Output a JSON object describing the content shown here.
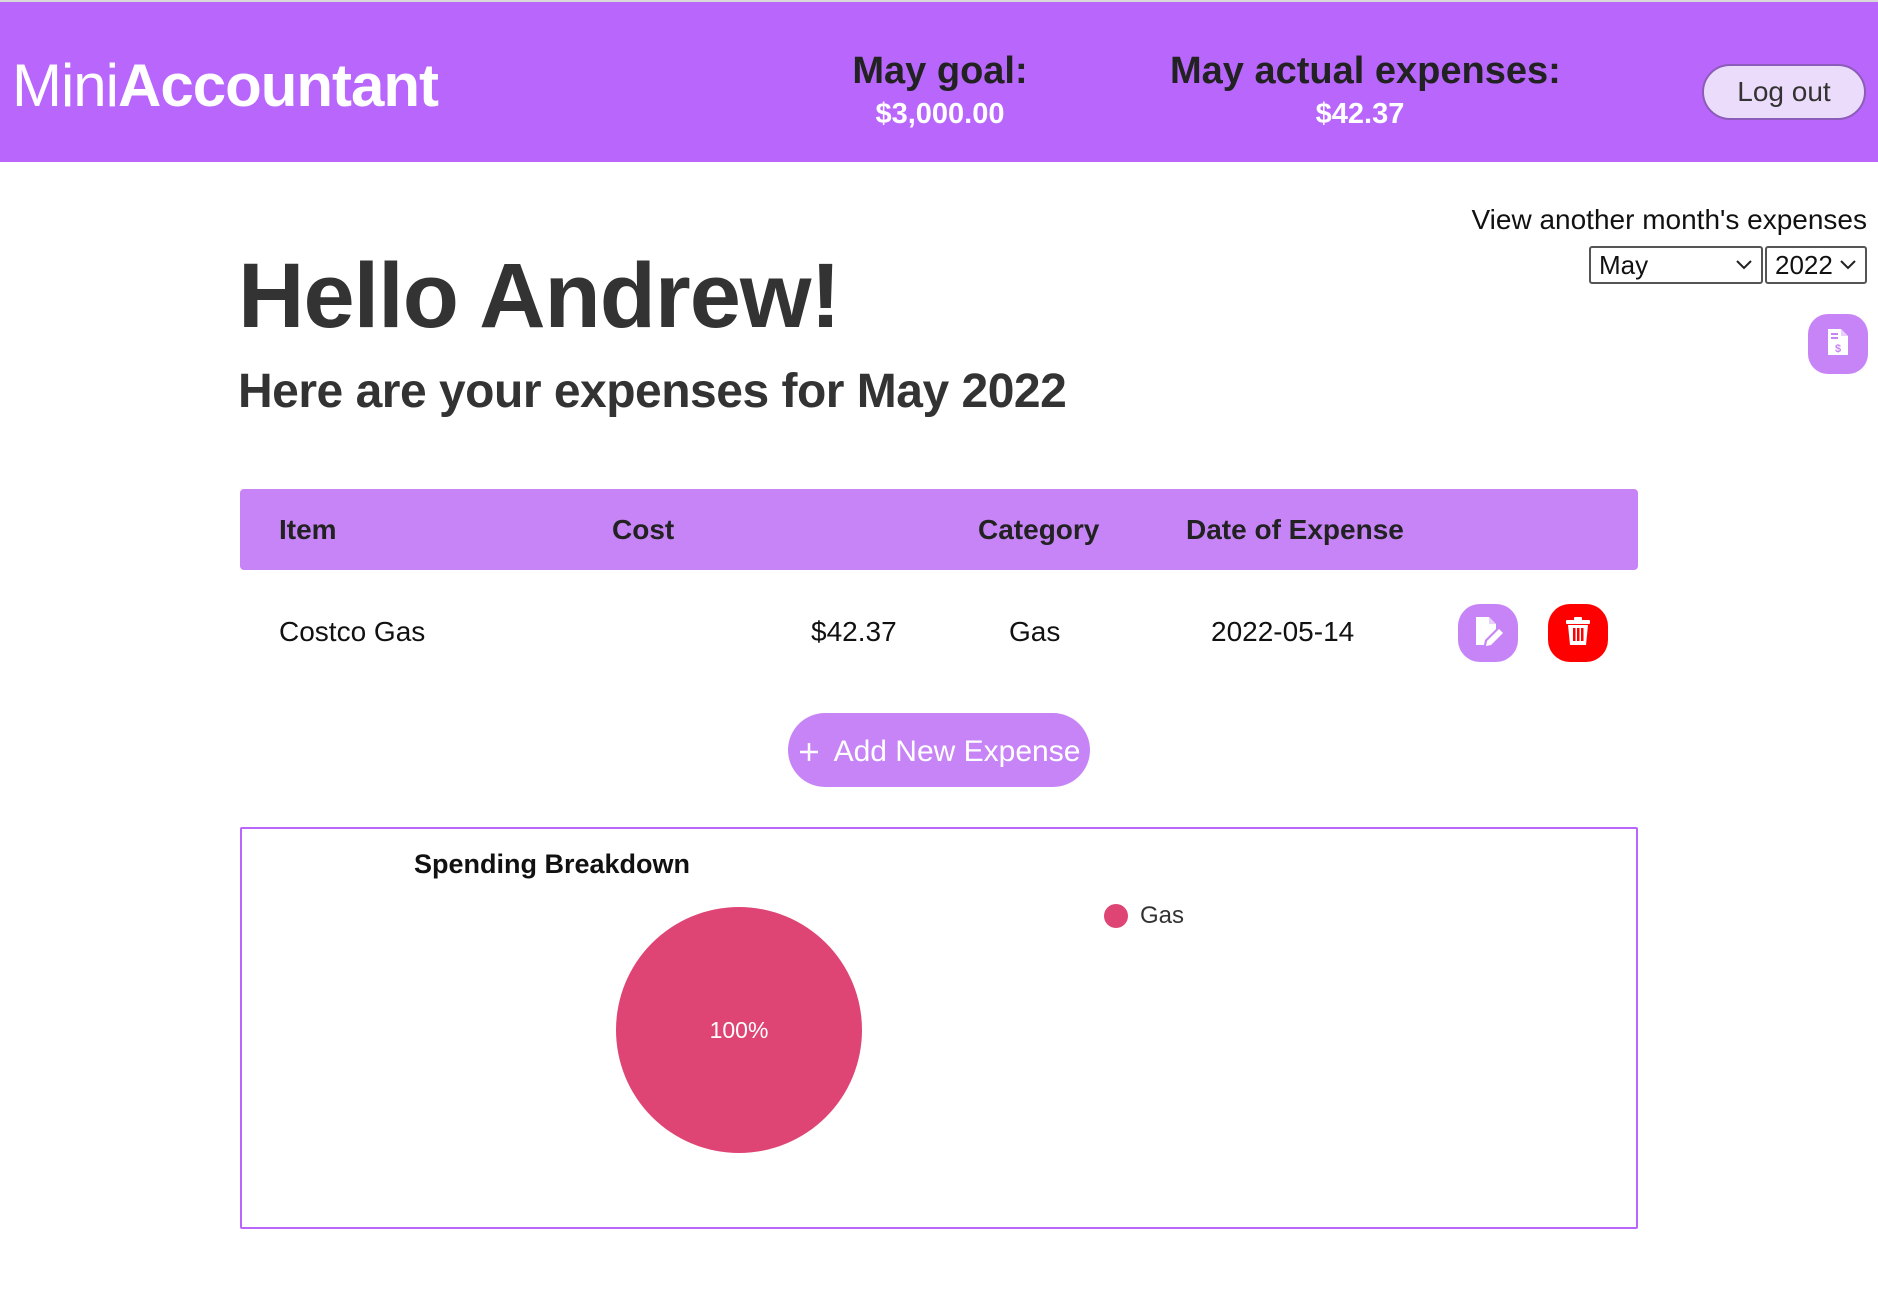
{
  "app": {
    "brand_light": "Mini",
    "brand_bold": "Accountant"
  },
  "header": {
    "goal_label": "May goal:",
    "goal_value": "$3,000.00",
    "actual_label": "May actual expenses:",
    "actual_value": "$42.37",
    "logout_label": "Log out"
  },
  "month_picker": {
    "label": "View another month's expenses",
    "month": "May",
    "year": "2022"
  },
  "greeting": {
    "title": "Hello Andrew!",
    "subtitle": "Here are your expenses for May 2022"
  },
  "table": {
    "headers": [
      "Item",
      "Cost",
      "Category",
      "Date of Expense"
    ],
    "rows": [
      {
        "item": "Costco Gas",
        "cost": "$42.37",
        "category": "Gas",
        "date": "2022-05-14"
      }
    ]
  },
  "add_button": {
    "label": "Add New Expense"
  },
  "chart_data": {
    "type": "pie",
    "title": "Spending Breakdown",
    "categories": [
      "Gas"
    ],
    "values": [
      100
    ],
    "labels": [
      "100%"
    ],
    "colors": [
      "#df4574"
    ],
    "legend": "top-right"
  },
  "colors": {
    "accent": "#b866fc",
    "accent_light": "#c784f7",
    "danger": "#ff0000",
    "pie_gas": "#df4574"
  },
  "icons": {
    "report": "file-invoice-dollar-icon",
    "edit": "file-edit-icon",
    "delete": "trash-icon",
    "add": "plus-icon",
    "dropdown": "chevron-down-icon"
  }
}
